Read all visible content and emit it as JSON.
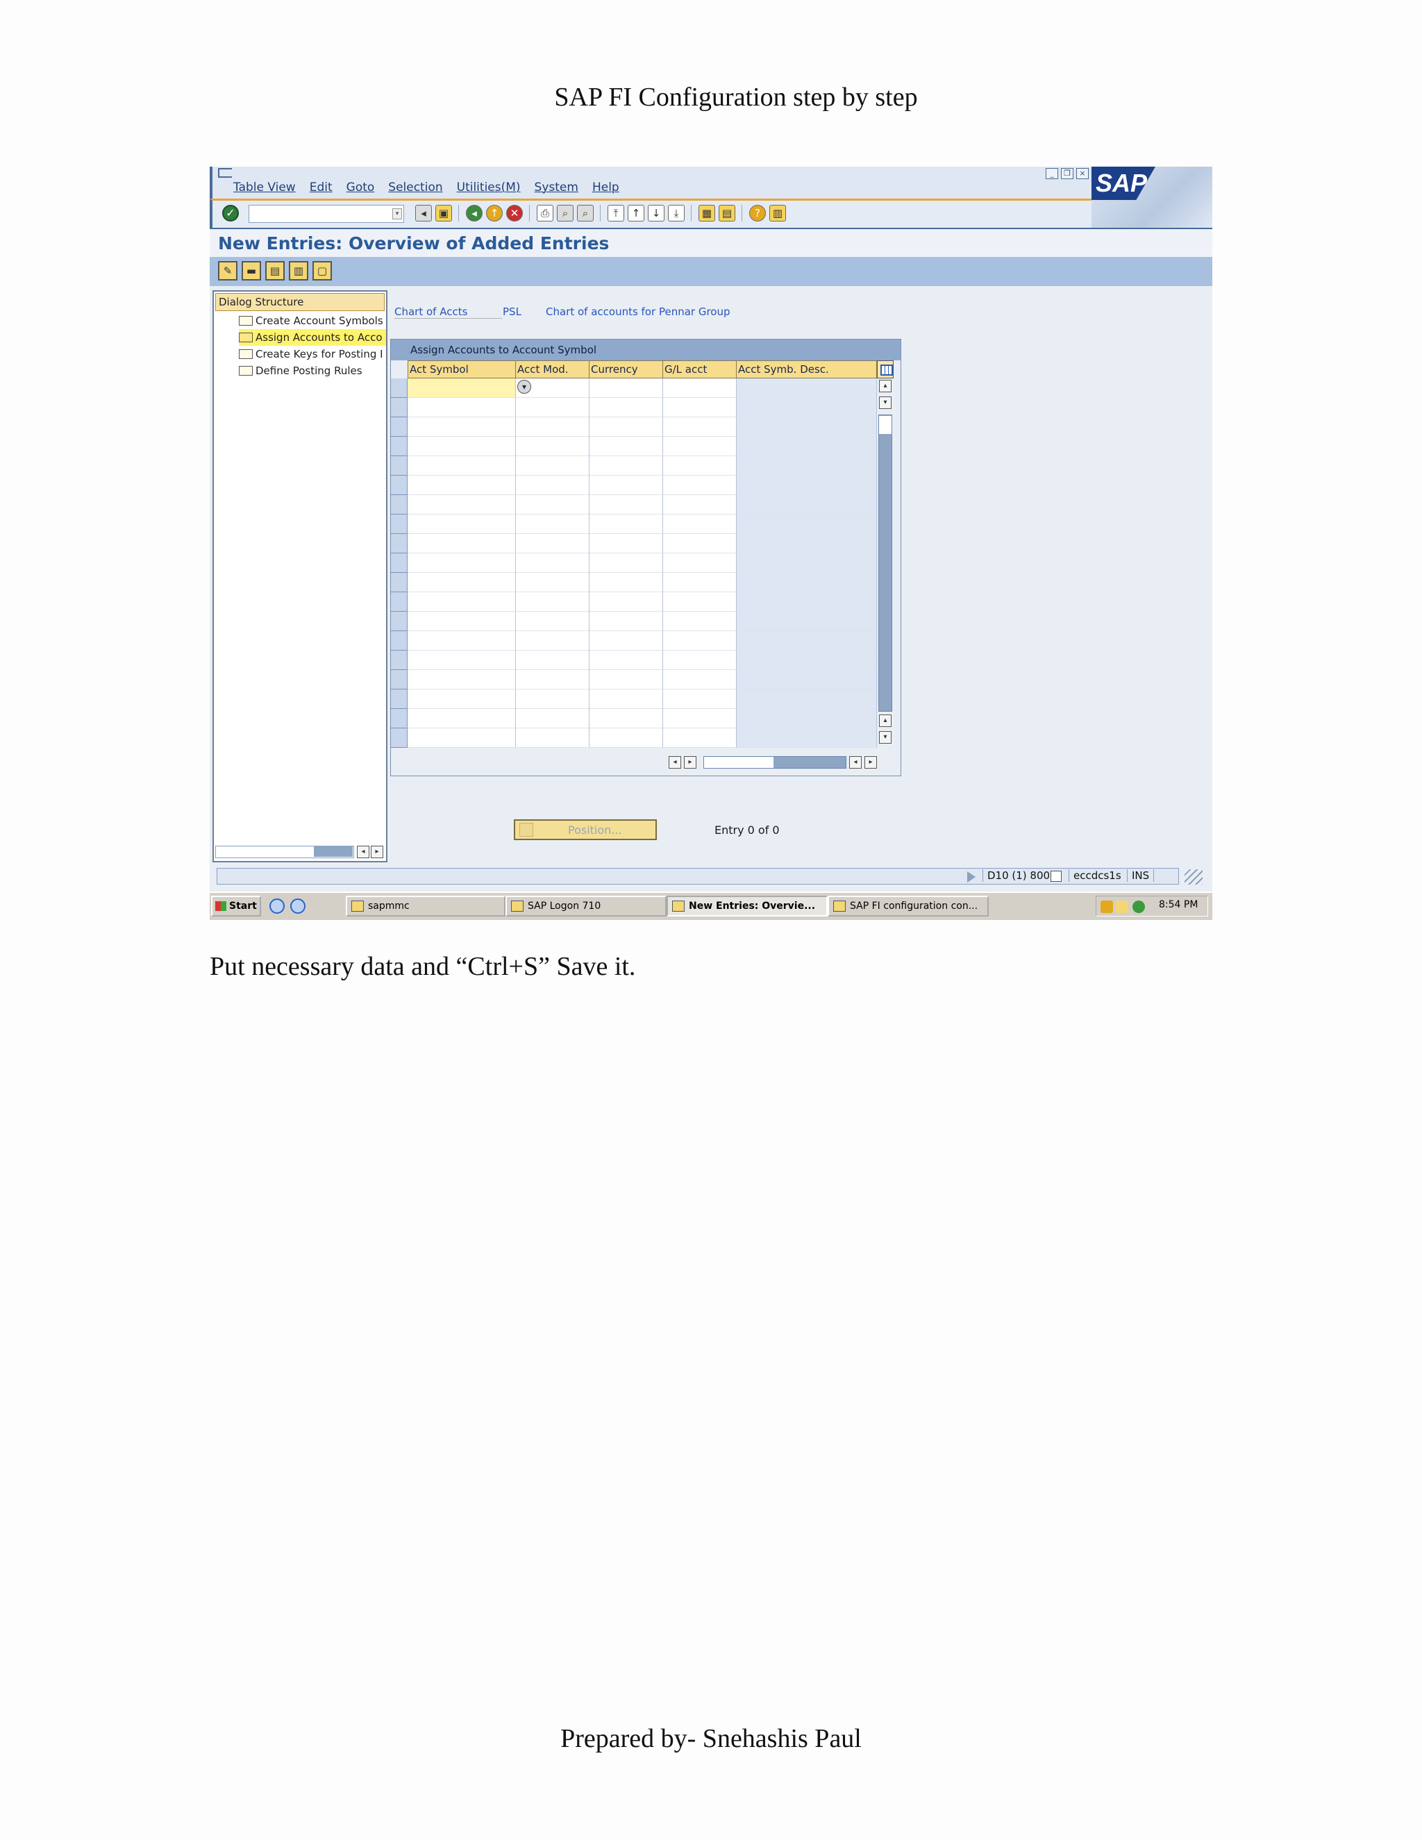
{
  "document": {
    "title": "SAP FI Configuration step by step",
    "instruction": "Put necessary data and “Ctrl+S” Save it.",
    "footer": "Prepared by- Snehashis Paul"
  },
  "sap_window": {
    "menu": [
      "Table View",
      "Edit",
      "Goto",
      "Selection",
      "Utilities(M)",
      "System",
      "Help"
    ],
    "logo_text": "SAP",
    "screen_title": "New Entries: Overview of Added Entries",
    "dialog_structure": {
      "header": "Dialog Structure",
      "nodes": [
        {
          "label": "Create Account Symbols",
          "active": false
        },
        {
          "label": "Assign Accounts to Acco",
          "active": true
        },
        {
          "label": "Create Keys for Posting I",
          "active": false
        },
        {
          "label": "Define Posting Rules",
          "active": false
        }
      ]
    },
    "header_fields": {
      "label": "Chart of Accts",
      "value": "PSL",
      "description": "Chart of accounts for Pennar Group"
    },
    "table": {
      "title": "Assign Accounts to Account Symbol",
      "columns": [
        "Act Symbol",
        "Acct Mod.",
        "Currency",
        "G/L acct",
        "Acct Symb. Desc."
      ],
      "visible_rows": 19
    },
    "position_button": "Position...",
    "entry_count": "Entry 0 of 0",
    "status": {
      "system": "D10 (1) 800",
      "host": "eccdcs1s",
      "mode": "INS"
    }
  },
  "taskbar": {
    "start": "Start",
    "tasks": [
      {
        "label": "sapmmc",
        "active": false
      },
      {
        "label": "SAP Logon 710",
        "active": false
      },
      {
        "label": "New Entries: Overvie...",
        "active": true
      },
      {
        "label": "SAP FI configuration con...",
        "active": false
      }
    ],
    "clock": "8:54 PM"
  }
}
